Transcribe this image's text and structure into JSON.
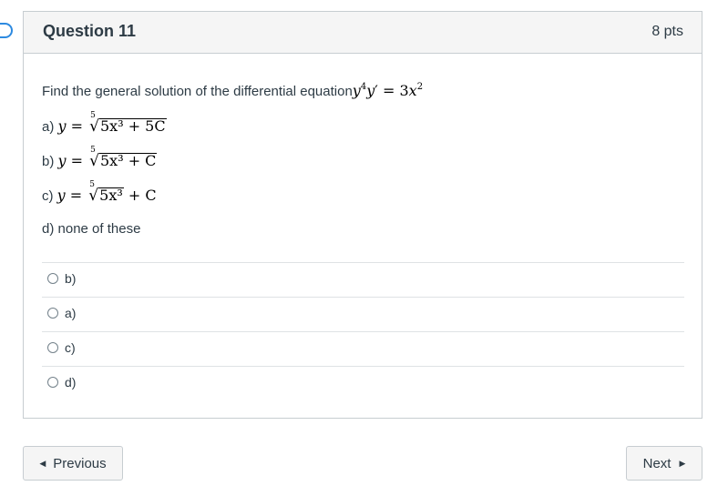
{
  "question": {
    "title": "Question 11",
    "points": "8 pts",
    "prompt": "Find the general solution of the differential equation",
    "equation": {
      "y_exp": "4",
      "rhs_coef": "3",
      "rhs_exp": "2"
    },
    "options": [
      {
        "label": "a)",
        "root_index": "5",
        "radicand": "5x³ + 5C",
        "outside": ""
      },
      {
        "label": "b)",
        "root_index": "5",
        "radicand": "5x³ + C",
        "outside": ""
      },
      {
        "label": "c)",
        "root_index": "5",
        "radicand": "5x³",
        "outside": "+ C"
      },
      {
        "label": "d)",
        "text": "none of these"
      }
    ],
    "answers": [
      {
        "label": "b)"
      },
      {
        "label": "a)"
      },
      {
        "label": "c)"
      },
      {
        "label": "d)"
      }
    ]
  },
  "navigation": {
    "previous_label": "Previous",
    "next_label": "Next"
  },
  "colors": {
    "border": "#c7cdd1",
    "header_bg": "#f5f5f5",
    "text": "#2d3b45",
    "flag": "#2d8ae0"
  }
}
